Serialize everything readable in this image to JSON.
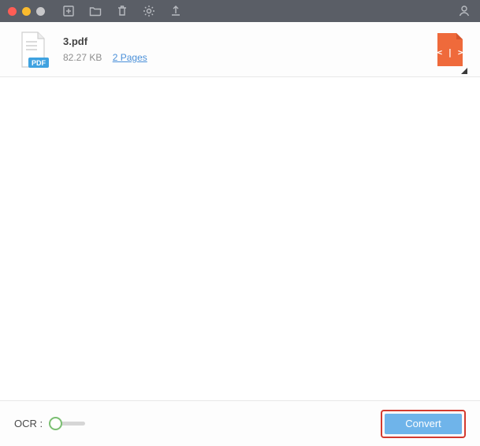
{
  "file": {
    "name": "3.pdf",
    "size": "82.27 KB",
    "pages": "2 Pages",
    "badge": "PDF"
  },
  "footer": {
    "ocr_label": "OCR :",
    "convert_label": "Convert"
  },
  "colors": {
    "accent_orange": "#ef6a3b",
    "pdf_blue": "#3fa2e0",
    "convert_bg": "#6fb4ea",
    "highlight_red": "#d33a2f"
  }
}
